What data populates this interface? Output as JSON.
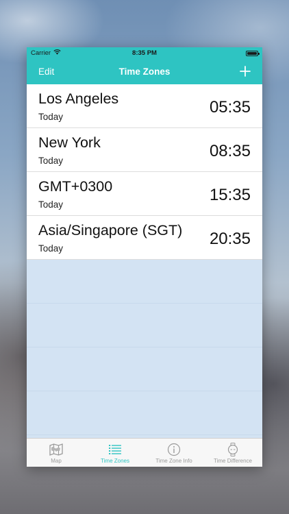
{
  "status_bar": {
    "carrier": "Carrier",
    "time": "8:35 PM"
  },
  "nav": {
    "left_label": "Edit",
    "title": "Time Zones",
    "add_icon": "plus-icon"
  },
  "zones": [
    {
      "city": "Los Angeles",
      "day": "Today",
      "time": "05:35"
    },
    {
      "city": "New York",
      "day": "Today",
      "time": "08:35"
    },
    {
      "city": "GMT+0300",
      "day": "Today",
      "time": "15:35"
    },
    {
      "city": "Asia/Singapore (SGT)",
      "day": "Today",
      "time": "20:35"
    }
  ],
  "tabs": [
    {
      "label": "Map",
      "icon": "map-icon",
      "active": false
    },
    {
      "label": "Time Zones",
      "icon": "list-icon",
      "active": true
    },
    {
      "label": "Time Zone Info",
      "icon": "info-icon",
      "active": false
    },
    {
      "label": "Time Difference",
      "icon": "watch-icon",
      "active": false
    }
  ],
  "colors": {
    "accent": "#2ec4c2",
    "empty_area": "#d3e3f3",
    "tab_inactive": "#9a9a9a"
  }
}
